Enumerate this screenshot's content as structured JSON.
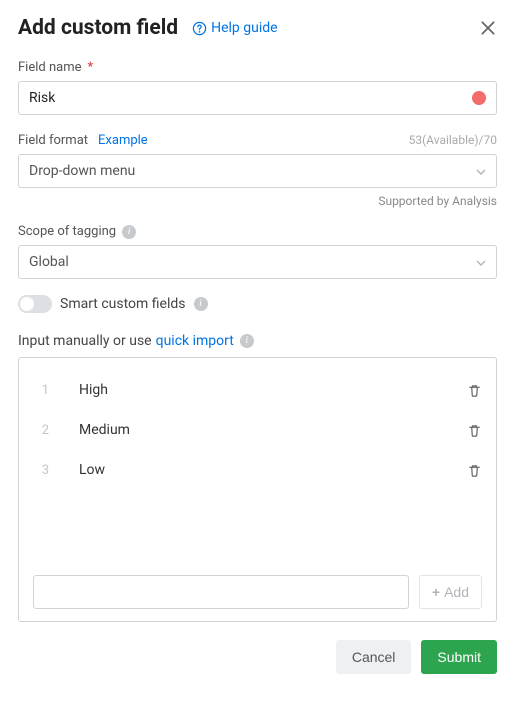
{
  "header": {
    "title": "Add custom field",
    "help_guide": "Help guide"
  },
  "field_name": {
    "label": "Field name",
    "value": "Risk",
    "indicator_color": "#f36b6b"
  },
  "field_format": {
    "label": "Field format",
    "example": "Example",
    "counter_used": "53",
    "counter_available": "(Available)",
    "counter_total": "/70",
    "value": "Drop-down menu",
    "supported": "Supported by Analysis"
  },
  "scope": {
    "label": "Scope of tagging",
    "value": "Global"
  },
  "smart": {
    "label": "Smart custom fields",
    "on": false
  },
  "manual": {
    "prefix": "Input manually or use ",
    "quick_import": "quick import"
  },
  "options": [
    {
      "n": "1",
      "label": "High"
    },
    {
      "n": "2",
      "label": "Medium"
    },
    {
      "n": "3",
      "label": "Low"
    }
  ],
  "add": {
    "button": "Add"
  },
  "footer": {
    "cancel": "Cancel",
    "submit": "Submit"
  }
}
